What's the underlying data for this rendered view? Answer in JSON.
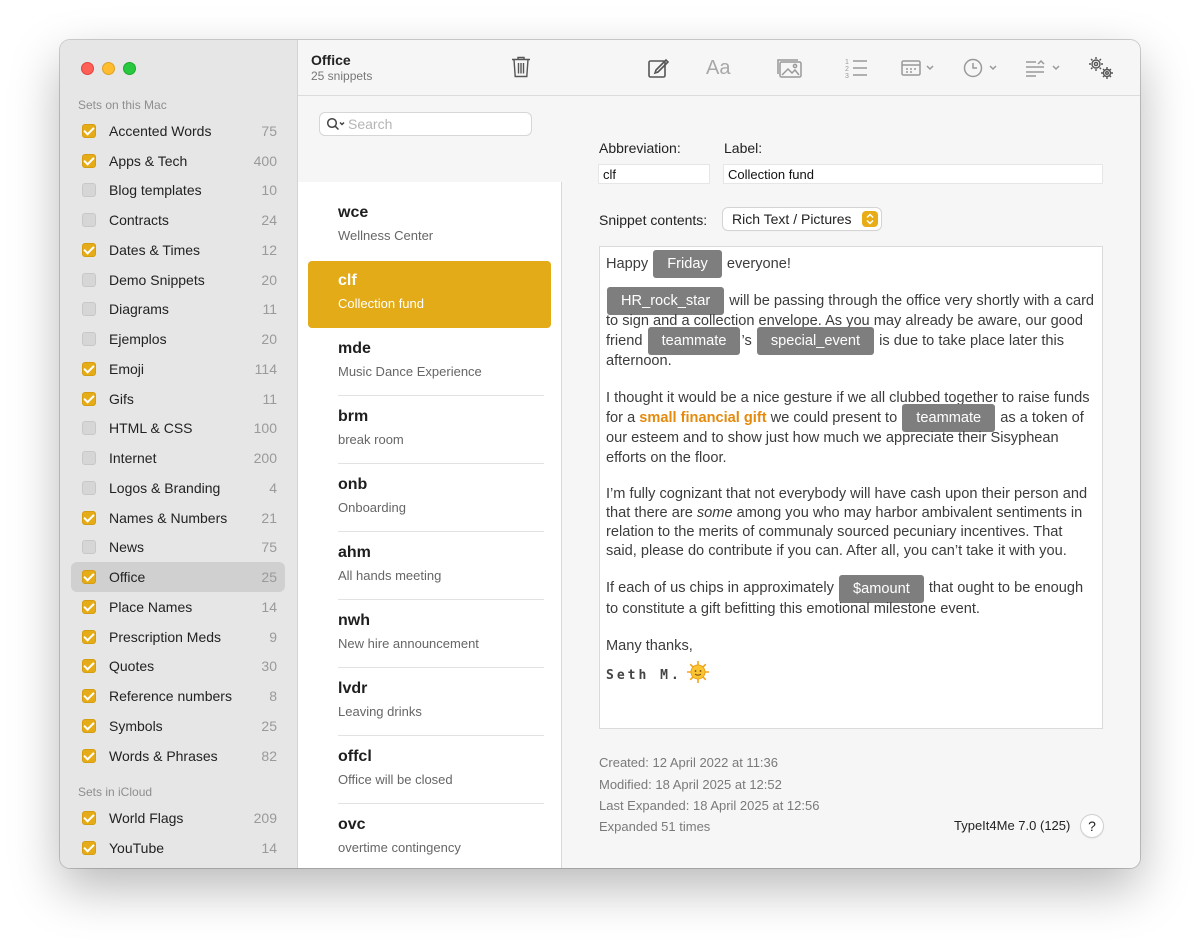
{
  "sidebar": {
    "local_heading": "Sets on this Mac",
    "local_sets": [
      {
        "label": "Accented Words",
        "count": "75",
        "checked": true
      },
      {
        "label": "Apps & Tech",
        "count": "400",
        "checked": true
      },
      {
        "label": "Blog templates",
        "count": "10",
        "checked": false
      },
      {
        "label": "Contracts",
        "count": "24",
        "checked": false
      },
      {
        "label": "Dates & Times",
        "count": "12",
        "checked": true
      },
      {
        "label": "Demo Snippets",
        "count": "20",
        "checked": false
      },
      {
        "label": "Diagrams",
        "count": "11",
        "checked": false
      },
      {
        "label": "Ejemplos",
        "count": "20",
        "checked": false
      },
      {
        "label": "Emoji",
        "count": "114",
        "checked": true
      },
      {
        "label": "Gifs",
        "count": "11",
        "checked": true
      },
      {
        "label": "HTML & CSS",
        "count": "100",
        "checked": false
      },
      {
        "label": "Internet",
        "count": "200",
        "checked": false
      },
      {
        "label": "Logos & Branding",
        "count": "4",
        "checked": false
      },
      {
        "label": "Names & Numbers",
        "count": "21",
        "checked": true
      },
      {
        "label": "News",
        "count": "75",
        "checked": false
      },
      {
        "label": "Office",
        "count": "25",
        "checked": true,
        "selected": true
      },
      {
        "label": "Place Names",
        "count": "14",
        "checked": true
      },
      {
        "label": "Prescription Meds",
        "count": "9",
        "checked": true
      },
      {
        "label": "Quotes",
        "count": "30",
        "checked": true
      },
      {
        "label": "Reference numbers",
        "count": "8",
        "checked": true
      },
      {
        "label": "Symbols",
        "count": "25",
        "checked": true
      },
      {
        "label": "Words & Phrases",
        "count": "82",
        "checked": true
      }
    ],
    "icloud_heading": "Sets in iCloud",
    "icloud_sets": [
      {
        "label": "World Flags",
        "count": "209",
        "checked": true
      },
      {
        "label": "YouTube",
        "count": "14",
        "checked": true
      }
    ]
  },
  "set_header": {
    "title": "Office",
    "subtitle": "25 snippets"
  },
  "search": {
    "placeholder": "Search",
    "value": ""
  },
  "snippets": [
    {
      "abbr": "wce",
      "label": "Wellness Center"
    },
    {
      "abbr": "clf",
      "label": "Collection fund",
      "selected": true
    },
    {
      "abbr": "mde",
      "label": "Music Dance Experience"
    },
    {
      "abbr": "brm",
      "label": "break room"
    },
    {
      "abbr": "onb",
      "label": "Onboarding"
    },
    {
      "abbr": "ahm",
      "label": "All hands meeting"
    },
    {
      "abbr": "nwh",
      "label": "New hire announcement"
    },
    {
      "abbr": "lvdr",
      "label": "Leaving drinks"
    },
    {
      "abbr": "offcl",
      "label": "Office will be closed"
    },
    {
      "abbr": "ovc",
      "label": "overtime contingency"
    }
  ],
  "toolbar_icons": [
    "compose-icon",
    "font-icon",
    "image-icon",
    "numbered-list-icon",
    "calendar-icon",
    "clock-icon",
    "fill-in-icon",
    "settings-icon"
  ],
  "detail": {
    "abbreviation_label": "Abbreviation:",
    "abbreviation_value": "clf",
    "label_label": "Label:",
    "label_value": "Collection fund",
    "contents_label": "Snippet contents:",
    "contents_type": "Rich Text / Pictures"
  },
  "body": {
    "p1_a": "Happy",
    "tok_friday": "Friday",
    "p1_b": "everyone!",
    "tok_hr": "HR_rock_star",
    "p2_a": "will be passing through the office very shortly with a card to sign and a collection envelope. As you may already be aware, our good friend",
    "tok_teammate": "teammate",
    "p2_b": "’s",
    "tok_event": "special_event",
    "p2_c": "is due to take place later this afternoon.",
    "p3_a": "I thought it would be a nice gesture if we all clubbed together to raise funds for a",
    "p3_hl": "small financial gift",
    "p3_b": "we could present to",
    "p3_c": "as a token of our esteem and to show just how much we appreciate their Sisyphean efforts on the floor.",
    "p4_a": "I’m fully cognizant that not everybody will have cash upon their person and that there are",
    "p4_em": "some",
    "p4_b": "among you who may harbor ambivalent sentiments in relation to the merits of communaly sourced pecuniary incentives. That said, please do contribute if you can. After all, you can’t take it with you.",
    "p5_a": "If each of us chips in approximately",
    "tok_amount": "$amount",
    "p5_b": "that ought to be enough to constitute a gift befitting this emotional milestone event.",
    "p6": "Many thanks,",
    "signature": "Seth M."
  },
  "meta": {
    "created": "Created: 12 April 2022 at 11:36",
    "modified": "Modified: 18 April 2025 at 12:52",
    "last_expanded": "Last Expanded: 18 April 2025 at 12:56",
    "expanded_count": "Expanded 51 times",
    "version": "TypeIt4Me 7.0 (125)",
    "help": "?"
  },
  "colors": {
    "accent": "#e2ab17",
    "token": "#7e7e7e",
    "highlight": "#e48a0d"
  }
}
